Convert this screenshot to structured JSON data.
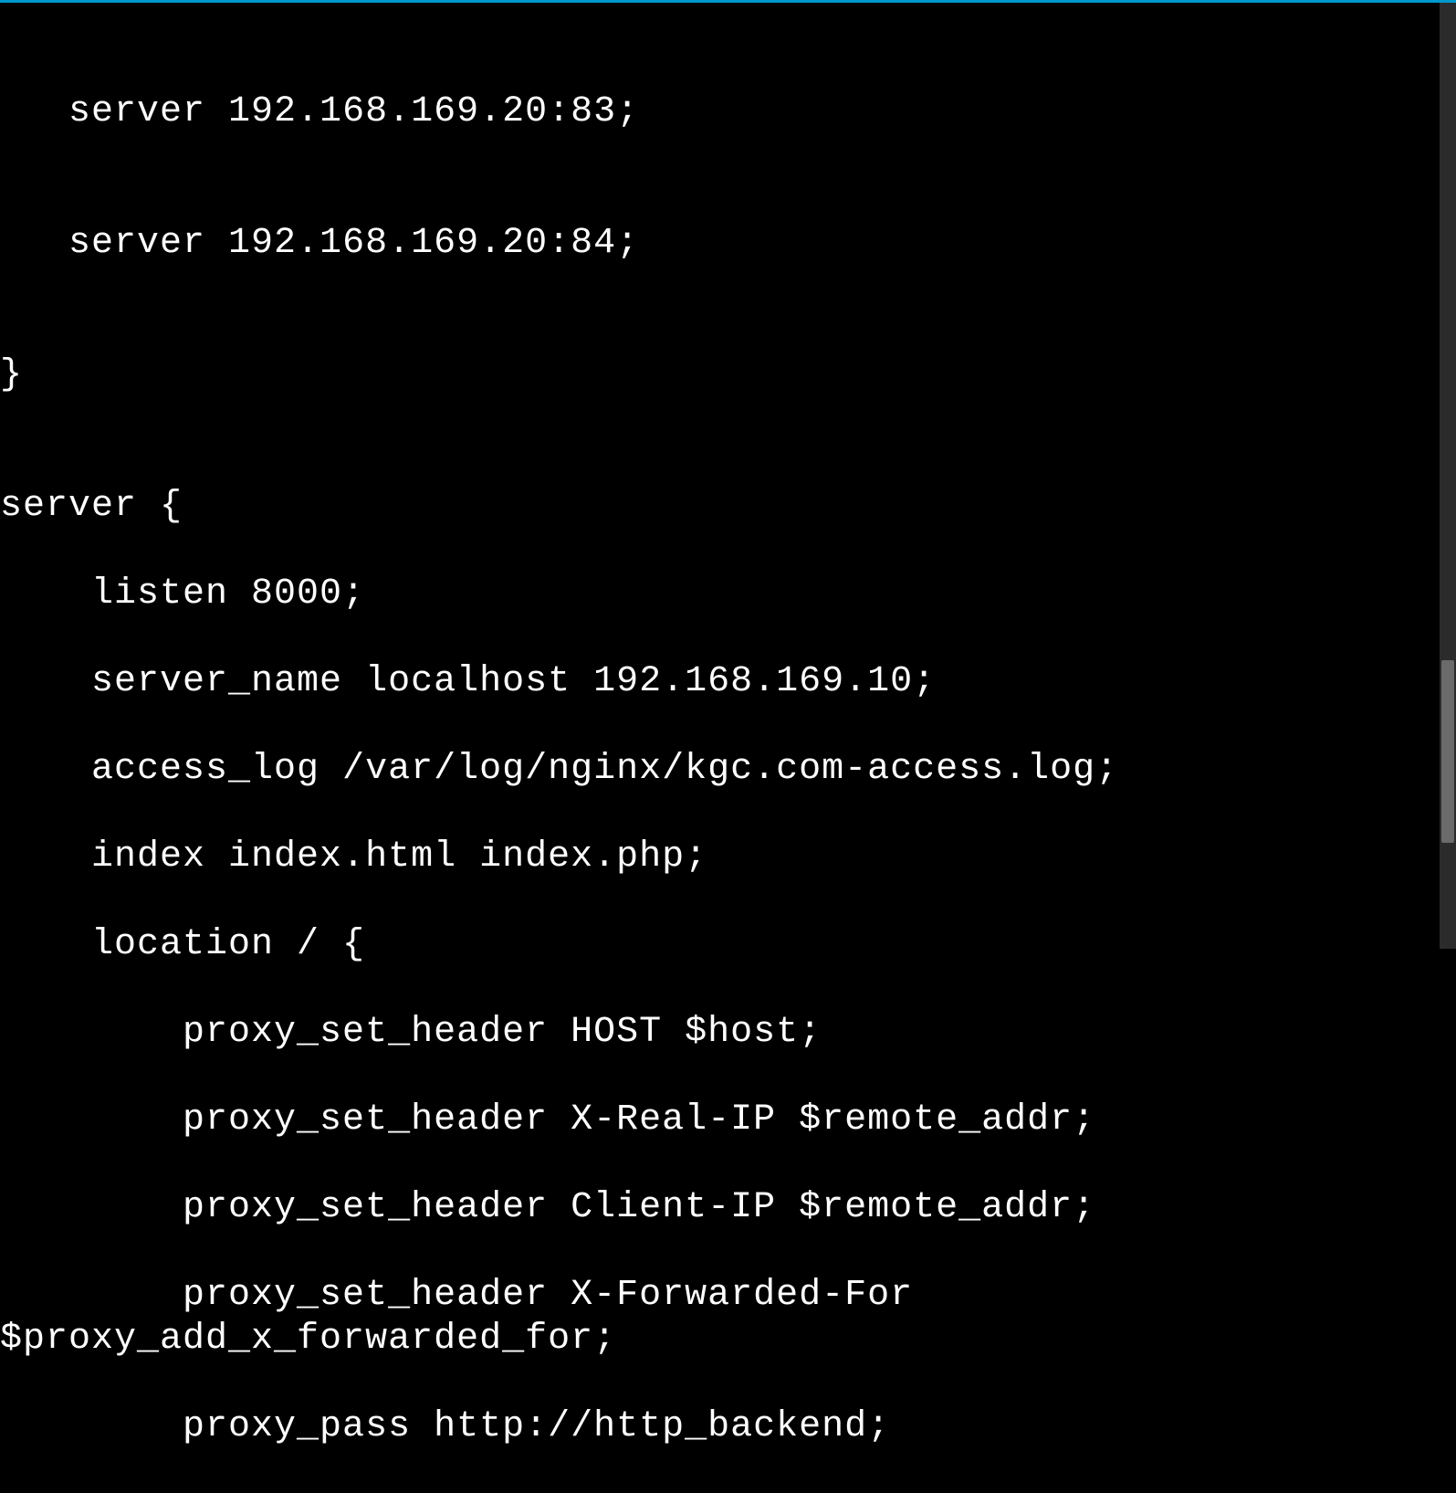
{
  "terminal": {
    "lines": [
      "",
      "   server 192.168.169.20:83;",
      "",
      "   server 192.168.169.20:84;",
      "",
      "}",
      "",
      "server {",
      "    listen 8000;",
      "    server_name localhost 192.168.169.10;",
      "    access_log /var/log/nginx/kgc.com-access.log;",
      "    index index.html index.php;",
      "    location / {",
      "        proxy_set_header HOST $host;",
      "        proxy_set_header X-Real-IP $remote_addr;",
      "        proxy_set_header Client-IP $remote_addr;",
      "        proxy_set_header X-Forwarded-For $proxy_add_x_forwarded_for;",
      "        proxy_pass http://http_backend;"
    ]
  }
}
